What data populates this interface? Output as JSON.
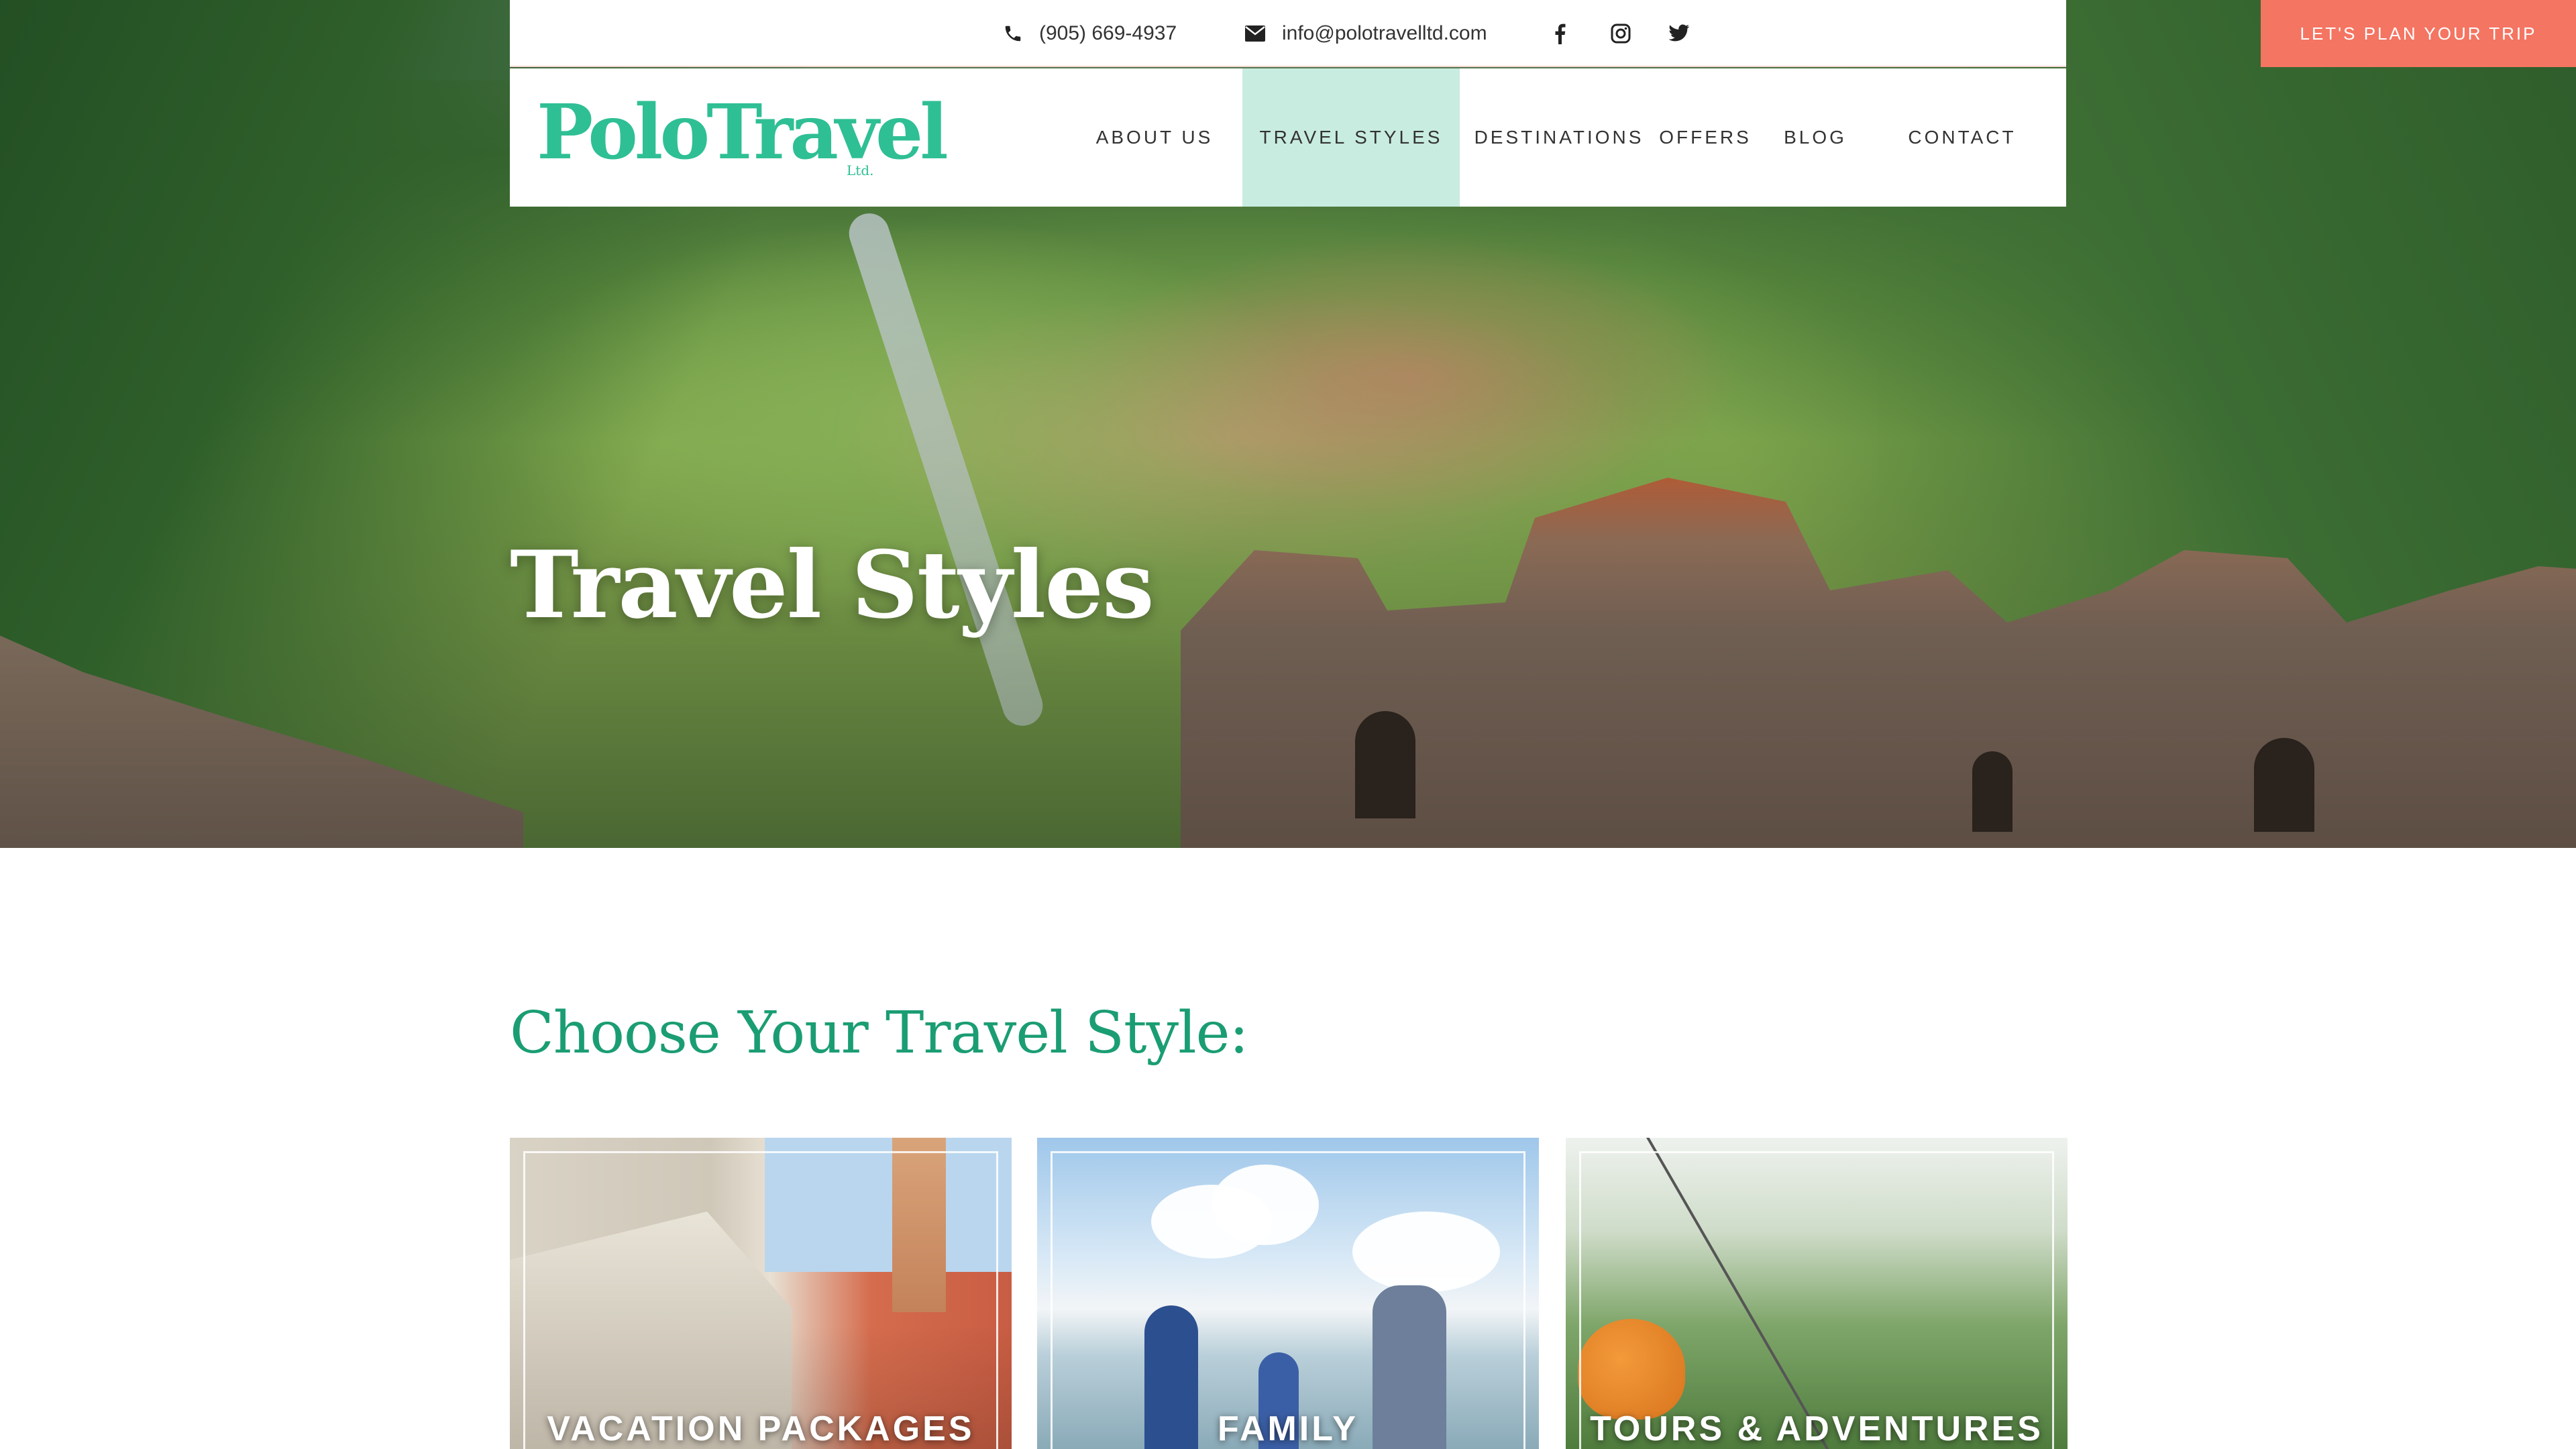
{
  "header": {
    "phone": "(905) 669-4937",
    "email": "info@polotravelltd.com",
    "social": [
      "facebook-icon",
      "instagram-icon",
      "twitter-icon"
    ],
    "cta_label": "LET'S PLAN YOUR TRIP",
    "logo_text": "PoloTravel",
    "logo_suffix": "Ltd."
  },
  "nav": {
    "items": [
      {
        "label": "ABOUT US"
      },
      {
        "label": "TRAVEL STYLES",
        "active": true
      },
      {
        "label": "DESTINATIONS"
      },
      {
        "label": "OFFERS"
      },
      {
        "label": "BLOG"
      },
      {
        "label": "CONTACT"
      }
    ]
  },
  "hero": {
    "title": "Travel Styles"
  },
  "main": {
    "section_title": "Choose Your Travel Style:",
    "cards": [
      {
        "label": "VACATION PACKAGES"
      },
      {
        "label": "FAMILY"
      },
      {
        "label": "TOURS & ADVENTURES"
      }
    ]
  },
  "colors": {
    "accent_green": "#2fbf94",
    "heading_green": "#1b9d73",
    "cta_coral": "#f47562",
    "nav_active_bg": "#c8ece0"
  }
}
